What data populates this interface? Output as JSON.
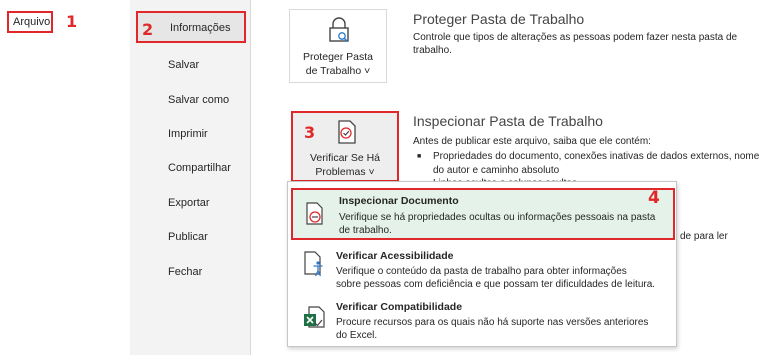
{
  "file_tab": {
    "label": "Arquivo"
  },
  "steps": [
    "1",
    "2",
    "3",
    "4"
  ],
  "nav": {
    "active": "Informações",
    "items": [
      "Salvar",
      "Salvar como",
      "Imprimir",
      "Compartilhar",
      "Exportar",
      "Publicar",
      "Fechar"
    ]
  },
  "protect": {
    "button_line1": "Proteger Pasta",
    "button_line2": "de Trabalho ˅",
    "title": "Proteger Pasta de Trabalho",
    "desc_line1": "Controle que tipos de alterações as pessoas podem fazer nesta pasta de",
    "desc_line2": "trabalho."
  },
  "inspect": {
    "button_line1": "Verificar Se Há",
    "button_line2": "Problemas ˅",
    "title": "Inspecionar Pasta de Trabalho",
    "desc": "Antes de publicar este arquivo, saiba que ele contém:",
    "bullet1_line1": "Propriedades do documento, conexões inativas de dados externos, nome",
    "bullet1_line2": "do autor e caminho absoluto",
    "bullet2_partial": "Linhas ocultas e colunas ocultas",
    "right_fragment": "de para ler"
  },
  "menu": {
    "items": [
      {
        "title": "Inspecionar Documento",
        "desc_line1": "Verifique se há propriedades ocultas ou informações pessoais na pasta",
        "desc_line2": "de trabalho."
      },
      {
        "title": "Verificar Acessibilidade",
        "desc_line1": "Verifique o conteúdo da pasta de trabalho para obter informações",
        "desc_line2": "sobre pessoas com deficiência e que possam ter dificuldades de leitura."
      },
      {
        "title": "Verificar Compatibilidade",
        "desc_line1": "Procure recursos para os quais não há suporte nas versões anteriores",
        "desc_line2": "do Excel."
      }
    ]
  },
  "colors": {
    "annotation": "#e0282a",
    "highlight": "#e4f2e9",
    "nav_bg": "#f3f3f3",
    "excel_green": "#1e7145"
  }
}
